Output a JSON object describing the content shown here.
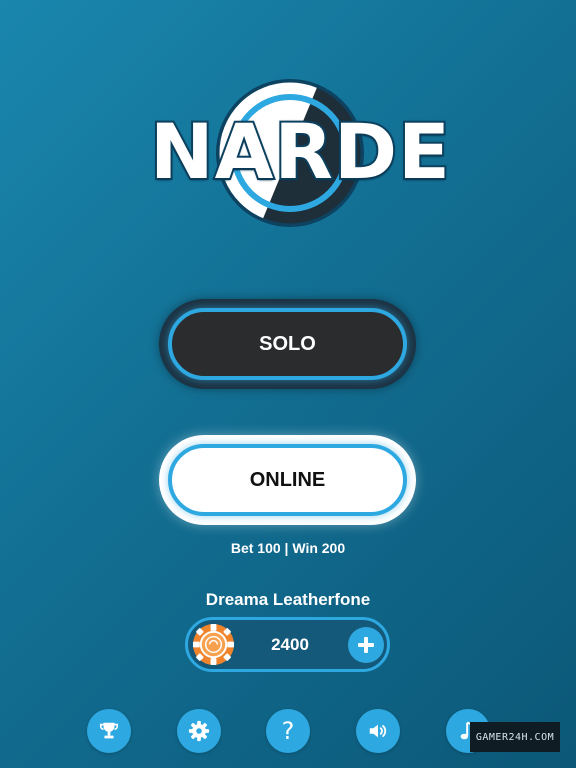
{
  "logo": {
    "title": "NARDE"
  },
  "menu": {
    "solo_label": "SOLO",
    "online_label": "ONLINE",
    "bet_info": "Bet 100 | Win 200"
  },
  "player": {
    "name": "Dreama Leatherfone",
    "balance": "2400"
  },
  "toolbar": {
    "icons": [
      "trophy-icon",
      "gear-icon",
      "question-icon",
      "speaker-icon",
      "music-note-icon"
    ],
    "help_glyph": "?"
  },
  "watermark": {
    "text": "GAMER24H.COM"
  },
  "colors": {
    "background": "#126f93",
    "accent": "#2ea8e0",
    "solo_button": "#2a2c2e",
    "online_button": "#ffffff",
    "chip": "#f0842c"
  }
}
